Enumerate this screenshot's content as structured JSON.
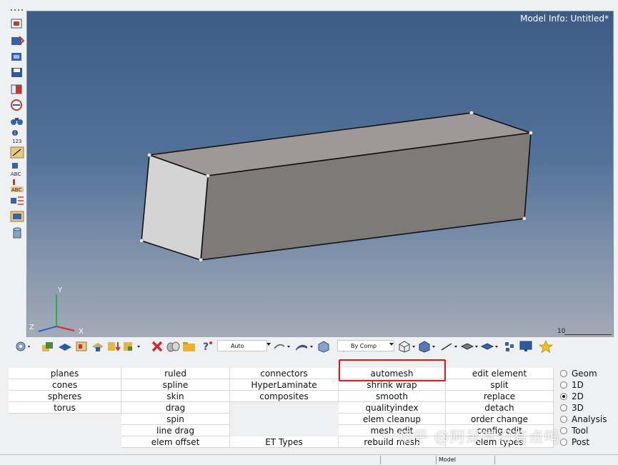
{
  "viewport": {
    "model_info": "Model Info: Untitled*",
    "axis_labels": {
      "x": "X",
      "y": "Y",
      "z": "Z"
    },
    "scale_value": "10",
    "background_top": "#3c5c86",
    "background_bottom": "#a3aab6"
  },
  "toolbar": {
    "display_mode": "Auto",
    "color_mode": "By Comp"
  },
  "panel": {
    "columns": [
      [
        "planes",
        "cones",
        "spheres",
        "torus",
        "",
        "",
        ""
      ],
      [
        "ruled",
        "spline",
        "skin",
        "drag",
        "spin",
        "line drag",
        "elem offset"
      ],
      [
        "connectors",
        "HyperLaminate",
        "composites",
        "",
        "",
        "",
        "ET Types"
      ],
      [
        "automesh",
        "shrink wrap",
        "smooth",
        "qualityindex",
        "elem cleanup",
        "mesh edit",
        "rebuild mesh"
      ],
      [
        "edit element",
        "split",
        "replace",
        "detach",
        "order change",
        "config edit",
        "elem types"
      ]
    ],
    "highlight_color": "#e01616"
  },
  "radios": {
    "items": [
      "Geom",
      "1D",
      "2D",
      "3D",
      "Analysis",
      "Tool",
      "Post"
    ],
    "selected": "2D"
  },
  "status_bar": {
    "model": "Model"
  },
  "watermark": "知乎 @阿呆学习有点吗",
  "icons": [
    "view-select-icon",
    "geometry-icon",
    "mesh-icon",
    "component-icon",
    "delete-icon",
    "save-icon",
    "help-icon",
    "star-icon"
  ]
}
